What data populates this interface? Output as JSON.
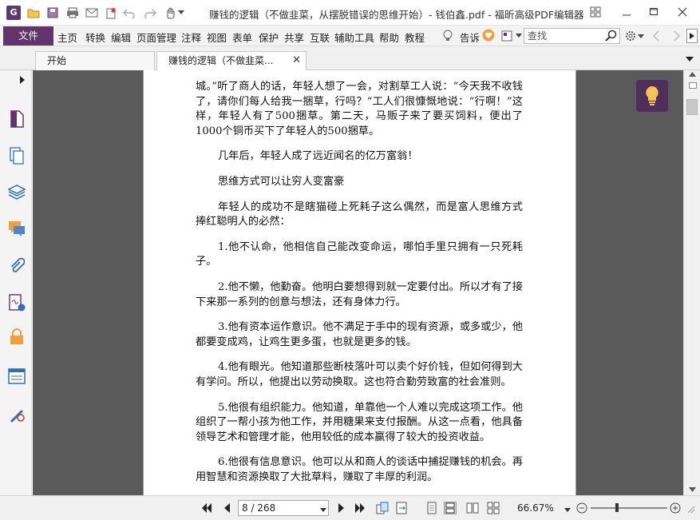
{
  "window": {
    "title": "赚钱的逻辑（不做韭菜，从摆脱错误的思维开始）- 钱伯鑫.pdf - 福昕高级PDF编辑器"
  },
  "menu": {
    "file": "文件",
    "items": [
      "主页",
      "转换",
      "编辑",
      "页面管理",
      "注释",
      "视图",
      "表单",
      "保护",
      "共享",
      "互联",
      "辅助工具",
      "帮助",
      "教程"
    ],
    "tell": "告诉",
    "search_placeholder": "查找"
  },
  "tabs": [
    {
      "label": "开始"
    },
    {
      "label": "赚钱的逻辑（不做韭菜..."
    }
  ],
  "document": {
    "paragraphs": [
      "城。”听了商人的话，年轻人想了一会，对割草工人说：“今天我不收钱了，请你们每人给我一捆草，行吗？”工人们很慷慨地说：“行啊！”这样，年轻人有了500捆草。第二天，马贩子来了要买饲料，便出了1000个铜币买下了年轻人的500捆草。",
      "几年后，年轻人成了远近闻名的亿万富翁！",
      "思维方式可以让穷人变富豪",
      "年轻人的成功不是瞎猫碰上死耗子这么偶然，而是富人思维方式捧红聪明人的必然：",
      "1.他不认命，他相信自己能改变命运，哪怕手里只拥有一只死耗子。",
      "2.他不懒，他勤奋。他明白要想得到就一定要付出。所以才有了接下来那一系列的创意与想法，还有身体力行。",
      "3.他有资本运作意识。他不满足于手中的现有资源，或多或少，他都要变成鸡，让鸡生更多蛋，也就是更多的钱。",
      "4.他有眼光。他知道那些断枝落叶可以卖个好价钱，但如何得到大有学问。所以，他提出以劳动换取。这也符合勤劳致富的社会准则。",
      "5.他很有组织能力。他知道，单靠他一个人难以完成这项工作。他组织了一帮小孩为他工作，并用糖果来支付报酬。从这一点看，他具备领导艺术和管理才能，他用较低的成本赢得了较大的投资收益。",
      "6.他很有信息意识。他可以从和商人的谈话中捕捉赚钱的机会。再用智慧和资源换取了大批草料，赚取了丰厚的利润。"
    ]
  },
  "status": {
    "page": "8 / 268",
    "zoom": "66.67%"
  },
  "icons": {
    "left_nav": [
      "page-thumbnail-icon",
      "pages-icon",
      "layers-icon",
      "comments-icon",
      "attachments-icon",
      "signature-icon",
      "security-icon",
      "form-fields-icon",
      "certificate-icon"
    ]
  },
  "colors": {
    "brand": "#61346b",
    "hint_button": "#4f2e5c",
    "document_background": "#5a5a5a"
  }
}
